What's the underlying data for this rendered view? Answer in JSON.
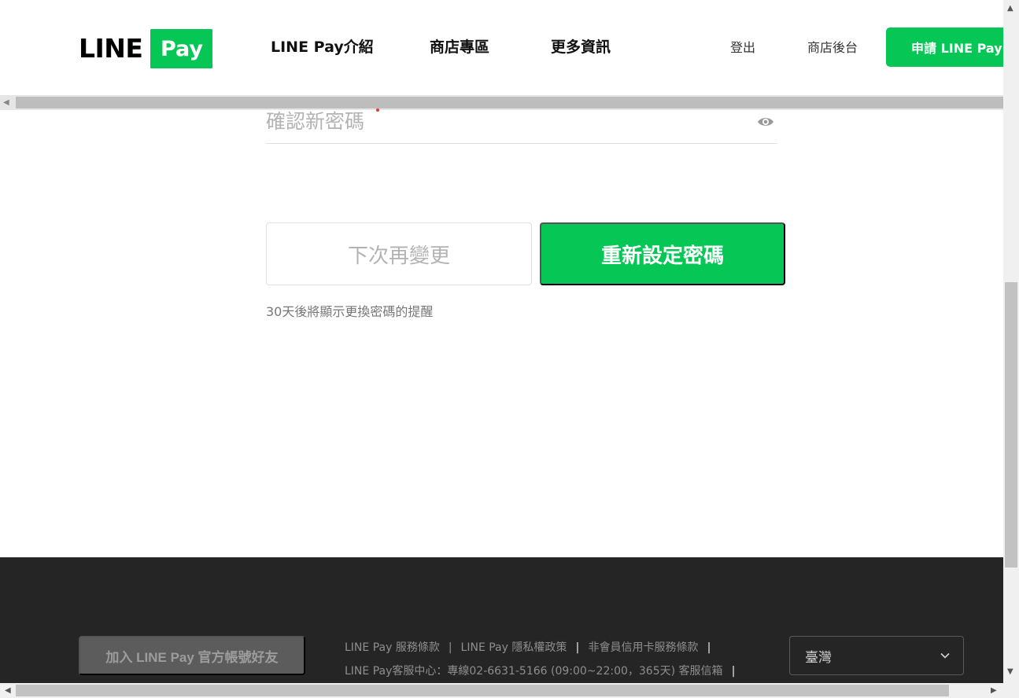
{
  "header": {
    "logo": {
      "line_text": "LINE",
      "pay_text": "Pay"
    },
    "nav": [
      {
        "label": "LINE Pay介紹"
      },
      {
        "label": "商店專區"
      },
      {
        "label": "更多資訊"
      }
    ],
    "logout_label": "登出",
    "merchant_backend_label": "商店後台",
    "apply_label": "申請 LINE Pay"
  },
  "form": {
    "confirm_password_label": "確認新密碼",
    "later_button_label": "下次再變更",
    "reset_button_label": "重新設定密碼",
    "reminder_text": "30天後將顯示更換密碼的提醒"
  },
  "footer": {
    "friend_button_label": "加入 LINE Pay 官方帳號好友",
    "links_row1": [
      "LINE Pay 服務條款",
      "LINE Pay 隱私權政策",
      "非會員信用卡服務條款"
    ],
    "links_row2": [
      "LINE Pay客服中心：專線02-6631-5166 (09:00~22:00，365天) 客服信箱"
    ],
    "region_label": "臺灣"
  },
  "colors": {
    "brand_green": "#06c755",
    "footer_bg": "#262526"
  },
  "icons": {
    "eye": "eye-icon",
    "chevron": "chevron-down-icon"
  }
}
